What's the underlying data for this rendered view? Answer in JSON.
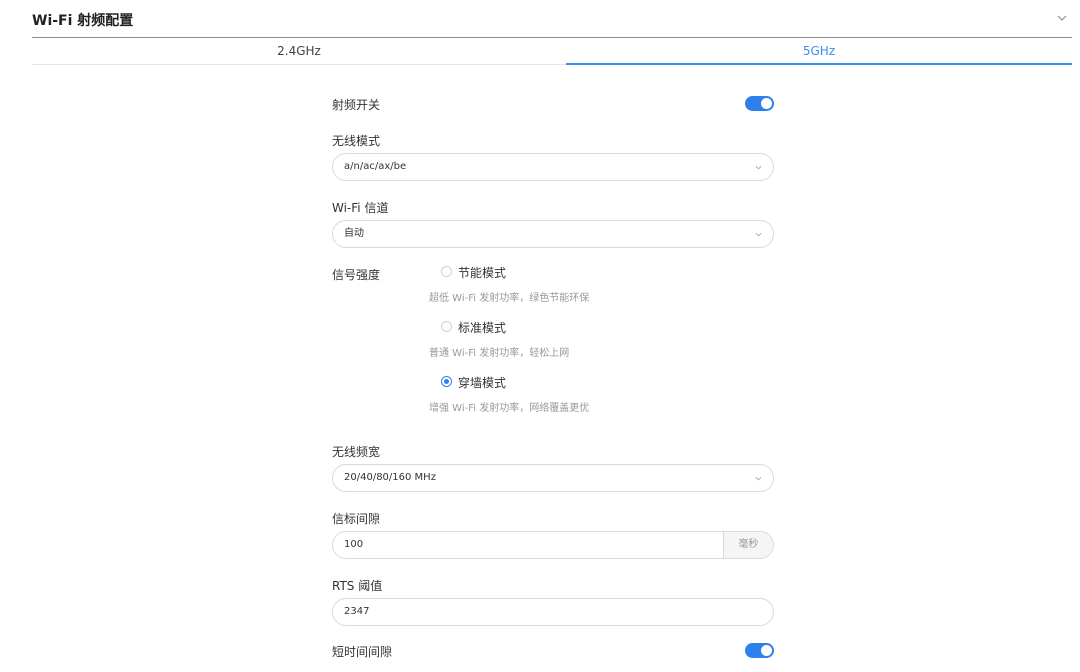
{
  "header": {
    "title": "Wi-Fi 射频配置",
    "chevron_icon": "chevron-down-icon"
  },
  "tabs": [
    {
      "label": "2.4GHz",
      "active": false
    },
    {
      "label": "5GHz",
      "active": true
    }
  ],
  "colors": {
    "accent": "#2f80ed",
    "tab_active": "#3b8ef0",
    "hint_text": "#999999",
    "border": "#d9d9d9"
  },
  "form": {
    "radio_switch": {
      "label": "射频开关",
      "enabled": true
    },
    "wireless_mode": {
      "label": "无线模式",
      "value": "a/n/ac/ax/be"
    },
    "channel": {
      "label": "Wi-Fi 信道",
      "value": "自动"
    },
    "signal_strength": {
      "label": "信号强度",
      "options": [
        {
          "label": "节能模式",
          "desc": "超低 Wi-Fi 发射功率，绿色节能环保",
          "selected": false
        },
        {
          "label": "标准模式",
          "desc": "普通 Wi-Fi 发射功率，轻松上网",
          "selected": false
        },
        {
          "label": "穿墙模式",
          "desc": "增强 Wi-Fi 发射功率，网络覆盖更优",
          "selected": true
        }
      ]
    },
    "bandwidth": {
      "label": "无线频宽",
      "value": "20/40/80/160 MHz"
    },
    "beacon_interval": {
      "label": "信标间隙",
      "value": "100",
      "unit": "毫秒"
    },
    "rts_threshold": {
      "label": "RTS 阈值",
      "value": "2347"
    },
    "short_gi": {
      "label": "短时间间隙",
      "enabled": true
    }
  }
}
